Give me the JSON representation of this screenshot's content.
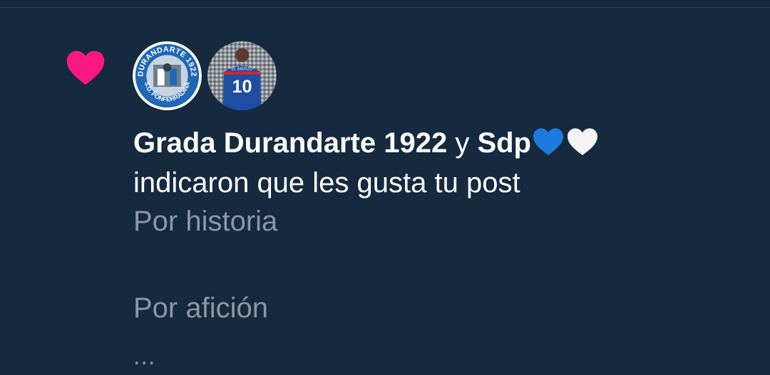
{
  "notification": {
    "icon": "heart-icon",
    "accent_color": "#f91880",
    "avatars": [
      {
        "name": "grada-durandarte-avatar",
        "icon": "club-crest-avatar",
        "crest_top": "DURANDARTE 1922",
        "crest_bottom": "S.D. PONFERRADINA"
      },
      {
        "name": "sdp-avatar",
        "icon": "football-player-avatar",
        "jersey_number": "10",
        "jersey_text": "EL BIERZO"
      }
    ],
    "headline": {
      "user1": "Grada Durandarte 1922",
      "connector": " y ",
      "user2": "Sdp",
      "emoji1": "blue-heart-icon",
      "emoji2": "white-heart-icon",
      "action": "indicaron que les gusta tu post"
    },
    "post_lines": [
      "Por historia",
      "Por afición"
    ],
    "ellipsis": "..."
  }
}
